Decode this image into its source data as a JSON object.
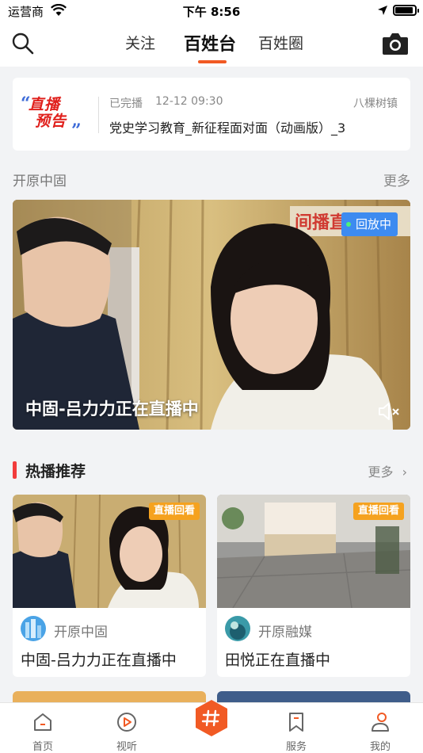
{
  "status_bar": {
    "carrier": "运营商",
    "time": "下午 8:56",
    "battery_level": 0.9
  },
  "top_nav": {
    "tabs": [
      {
        "label": "关注",
        "active": false
      },
      {
        "label": "百姓台",
        "active": true
      },
      {
        "label": "百姓圈",
        "active": false
      }
    ],
    "accent_color": "#f15a24"
  },
  "live_preview": {
    "logo_text": [
      "直播",
      "预告"
    ],
    "status": "已完播",
    "date": "12-12 09:30",
    "place": "八棵树镇",
    "title": "党史学习教育_新征程面对面（动画版）_3"
  },
  "section_kaiyuan": {
    "title": "开原中固",
    "more": "更多"
  },
  "live_card": {
    "badge": "回放中",
    "title": "中固-吕力力正在直播中"
  },
  "hot_section": {
    "title": "热播推荐",
    "more": "更多",
    "items": [
      {
        "badge": "直播回看",
        "author": "开原中固",
        "title": "中固-吕力力正在直播中"
      },
      {
        "badge": "直播回看",
        "author": "开原融媒",
        "title": "田悦正在直播中"
      }
    ]
  },
  "tab_bar": {
    "items": [
      {
        "label": "首页",
        "icon": "home-icon"
      },
      {
        "label": "视听",
        "icon": "play-icon"
      },
      {
        "label": "",
        "icon": "hashtag-icon"
      },
      {
        "label": "服务",
        "icon": "bookmark-icon"
      },
      {
        "label": "我的",
        "icon": "profile-icon"
      }
    ]
  }
}
